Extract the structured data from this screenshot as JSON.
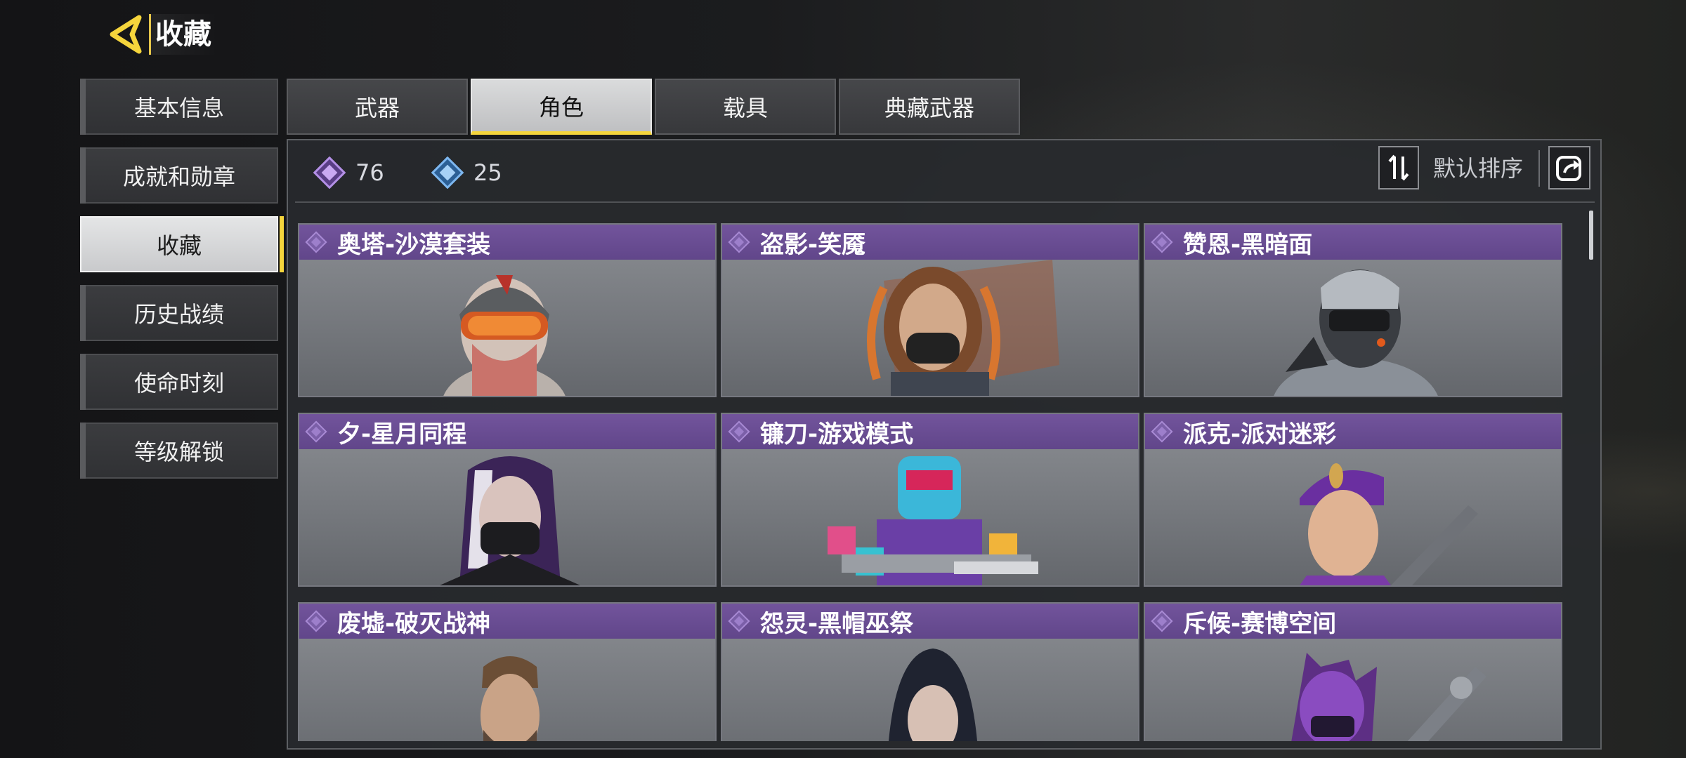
{
  "header": {
    "title": "收藏"
  },
  "sidebar": {
    "items": [
      {
        "label": "基本信息"
      },
      {
        "label": "成就和勋章"
      },
      {
        "label": "收藏",
        "active": true
      },
      {
        "label": "历史战绩"
      },
      {
        "label": "使命时刻"
      },
      {
        "label": "等级解锁"
      }
    ]
  },
  "tabs": [
    {
      "label": "武器"
    },
    {
      "label": "角色",
      "active": true
    },
    {
      "label": "载具"
    },
    {
      "label": "典藏武器"
    }
  ],
  "stats": {
    "purple_count": "76",
    "blue_count": "25"
  },
  "sort": {
    "label": "默认排序"
  },
  "cards": [
    {
      "title": "奥塔-沙漠套装",
      "icon": "diamond-icon"
    },
    {
      "title": "盗影-笑魇",
      "icon": "diamond-icon"
    },
    {
      "title": "赞恩-黑暗面",
      "icon": "diamond-icon"
    },
    {
      "title": "夕-星月同程",
      "icon": "diamond-icon"
    },
    {
      "title": "镰刀-游戏模式",
      "icon": "diamond-icon"
    },
    {
      "title": "派克-派对迷彩",
      "icon": "diamond-icon"
    },
    {
      "title": "废墟-破灭战神",
      "icon": "diamond-icon"
    },
    {
      "title": "怨灵-黑帽巫祭",
      "icon": "diamond-icon"
    },
    {
      "title": "斥候-赛博空间",
      "icon": "diamond-icon"
    }
  ],
  "colors": {
    "accent": "#f5d53c",
    "card_header": "#6a4d95",
    "purple_gem": "#a27ad6",
    "blue_gem": "#6aa5e6"
  }
}
